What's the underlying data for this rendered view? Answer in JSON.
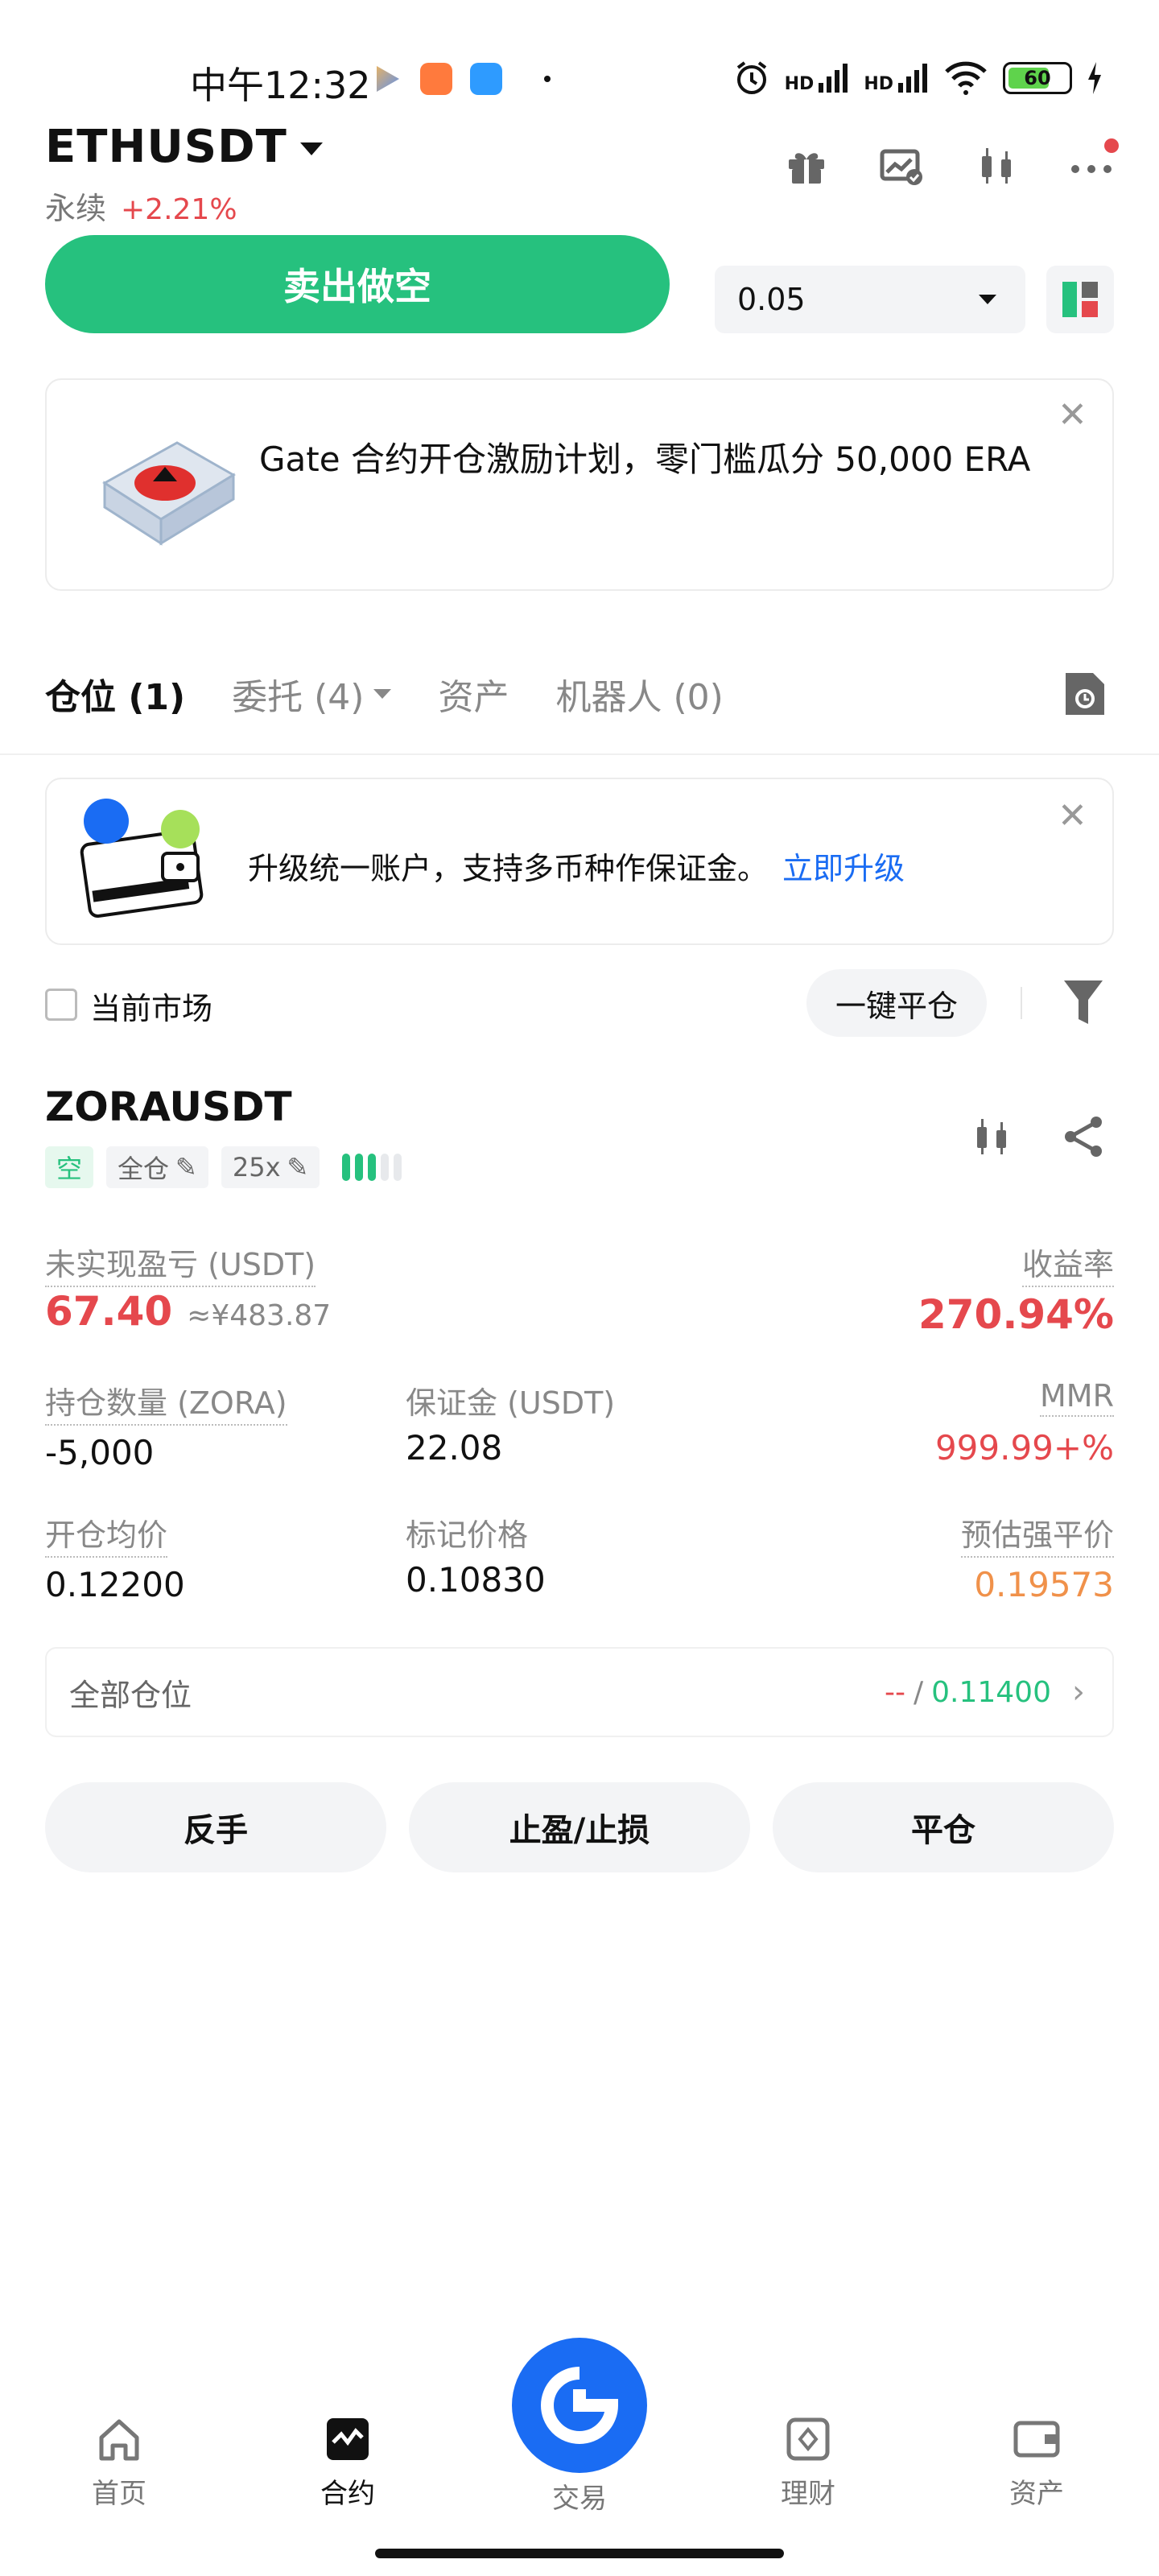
{
  "status_bar": {
    "time": "中午12:32",
    "signal_1": "HD",
    "signal_2": "HD",
    "battery": "60"
  },
  "header": {
    "pair": "ETHUSDT",
    "type": "永续",
    "change": "+2.21%"
  },
  "trade": {
    "sell_label": "卖出做空",
    "amount": "0.05"
  },
  "promo": {
    "text": "Gate 合约开仓激励计划，零门槛瓜分 50,000 ERA"
  },
  "tabs": [
    {
      "label": "仓位 (1)"
    },
    {
      "label": "委托 (4)"
    },
    {
      "label": "资产"
    },
    {
      "label": "机器人 (0)"
    }
  ],
  "upgrade": {
    "text": "升级统一账户，支持多币种作保证金。",
    "link": "立即升级"
  },
  "filter": {
    "current_market": "当前市场",
    "close_all": "一键平仓"
  },
  "position": {
    "symbol": "ZORAUSDT",
    "side_tag": "空",
    "margin_mode": "全仓",
    "leverage": "25x",
    "unrealized_label": "未实现盈亏 (USDT)",
    "unrealized_value": "67.40",
    "unrealized_cny": "≈¥483.87",
    "roe_label": "收益率",
    "roe_value": "270.94%",
    "size_label": "持仓数量 (ZORA)",
    "size_value": "-5,000",
    "margin_label": "保证金 (USDT)",
    "margin_value": "22.08",
    "mmr_label": "MMR",
    "mmr_value": "999.99+%",
    "entry_label": "开仓均价",
    "entry_value": "0.12200",
    "mark_label": "标记价格",
    "mark_value": "0.10830",
    "liq_label": "预估强平价",
    "liq_value": "0.19573",
    "all_positions_label": "全部仓位",
    "all_positions_tp": "--",
    "all_positions_sl": "0.11400",
    "risk_level_fraction": 0.6
  },
  "actions": {
    "reverse": "反手",
    "tpsl": "止盈/止损",
    "close": "平仓"
  },
  "nav": [
    {
      "label": "首页",
      "icon": "home-icon"
    },
    {
      "label": "合约",
      "icon": "futures-icon"
    },
    {
      "label": "交易",
      "icon": "trade-icon"
    },
    {
      "label": "理财",
      "icon": "earn-icon"
    },
    {
      "label": "资产",
      "icon": "wallet-icon"
    }
  ],
  "colors": {
    "green": "#26c17e",
    "red": "#e5484d",
    "blue": "#1a6cf3",
    "orange": "#f0914a"
  }
}
